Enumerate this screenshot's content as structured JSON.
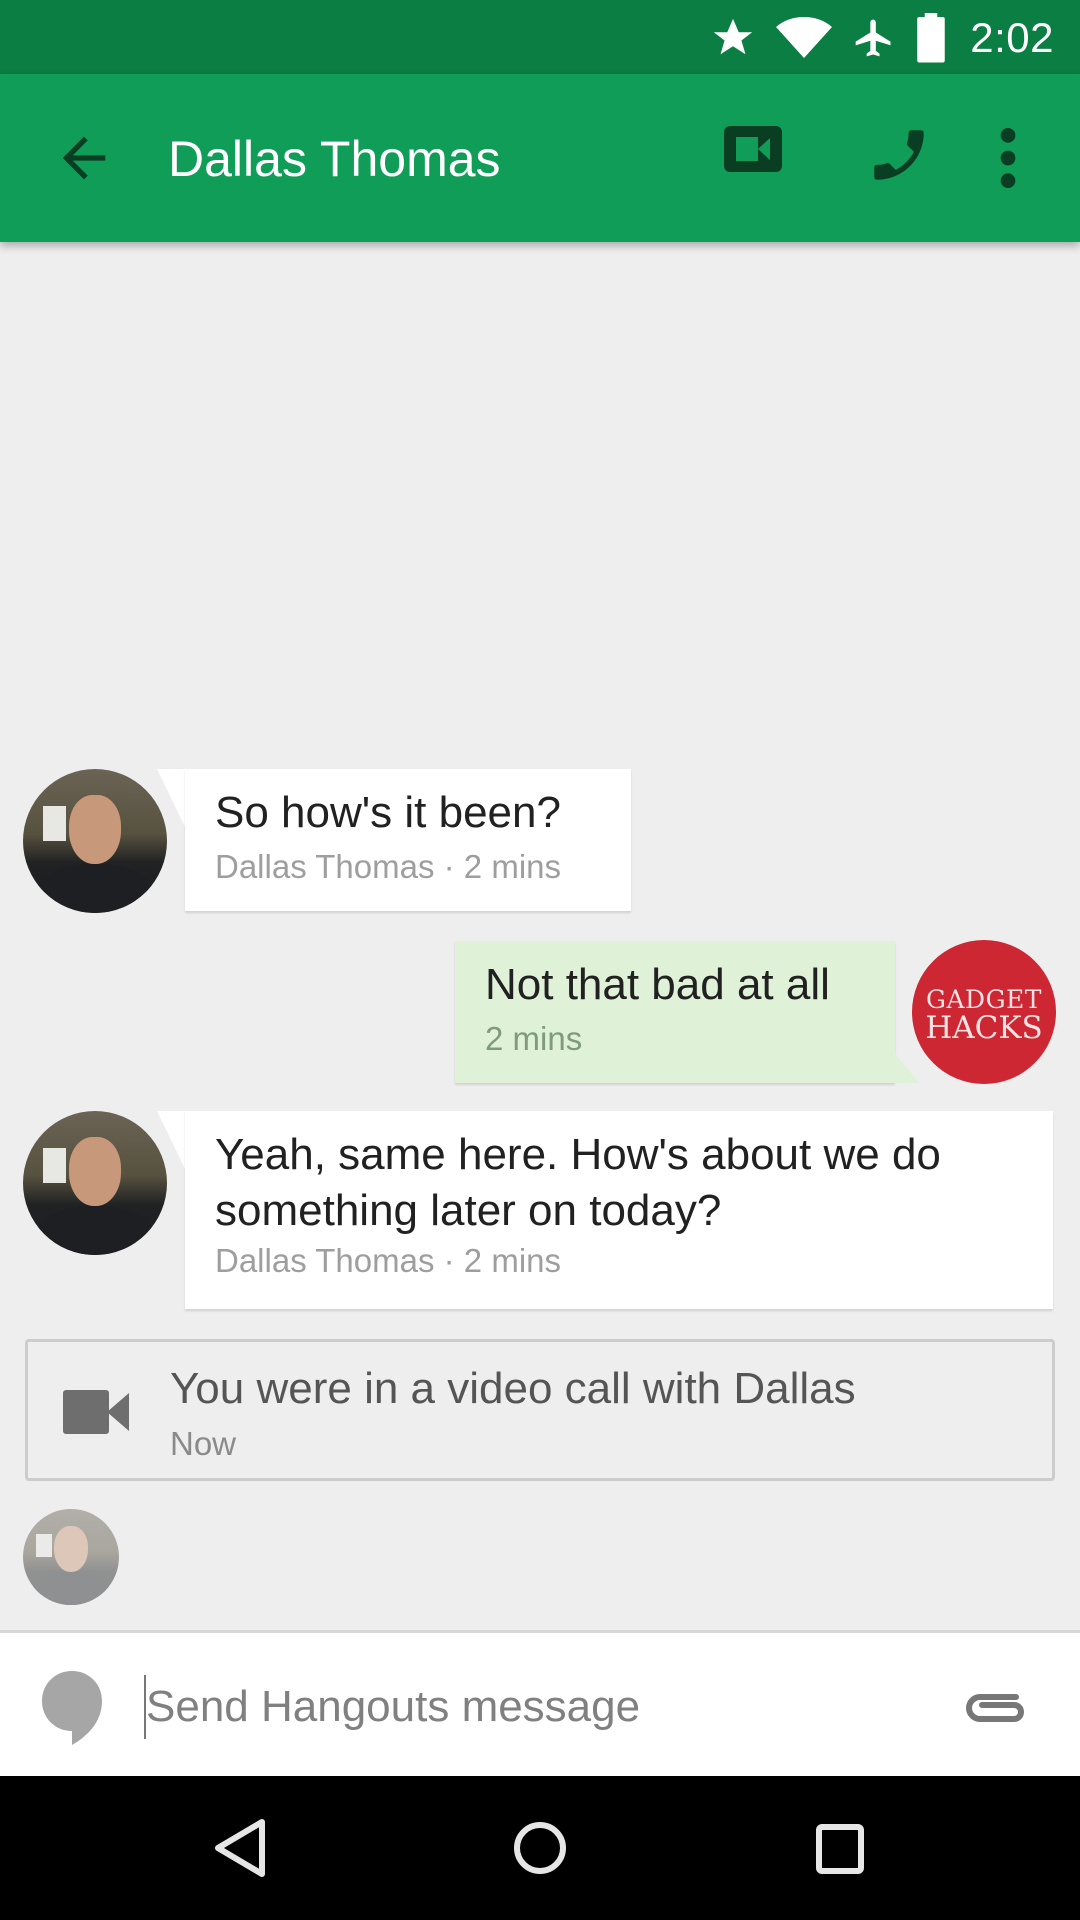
{
  "status_bar": {
    "time": "2:02",
    "icons": [
      "star-icon",
      "wifi-icon",
      "airplane-mode-icon",
      "battery-icon"
    ]
  },
  "app_bar": {
    "title": "Dallas Thomas",
    "back_icon": "arrow-back-icon",
    "actions": [
      "video-call-icon",
      "phone-icon",
      "more-vert-icon"
    ],
    "background": "#109d58",
    "status_background": "#0b7e43"
  },
  "messages": [
    {
      "direction": "incoming",
      "text": "So how's it been?",
      "meta": "Dallas Thomas · 2 mins",
      "avatar": "dallas-thomas-photo"
    },
    {
      "direction": "outgoing",
      "text": "Not that bad at all",
      "meta": "2 mins",
      "avatar": {
        "line1": "GADGET",
        "line2": "HACKS"
      },
      "bubble_color": "#dff2d8"
    },
    {
      "direction": "incoming",
      "text_line1": "Yeah, same here. How's about we do",
      "text_line2": "something later on today?",
      "meta": "Dallas Thomas · 2 mins",
      "avatar": "dallas-thomas-photo"
    }
  ],
  "call_event": {
    "icon": "videocam-icon",
    "text": "You were in a video call with Dallas",
    "time": "Now"
  },
  "read_receipt": {
    "avatar": "dallas-thomas-photo"
  },
  "compose": {
    "placeholder": "Send Hangouts message",
    "value": "",
    "left_icon": "hangouts-icon",
    "right_icon": "attach-icon"
  },
  "nav_bar": {
    "buttons": [
      "back",
      "home",
      "recents"
    ]
  },
  "colors": {
    "accent": "#109d58",
    "chat_background": "#eeeeee",
    "gadget_hacks_red": "#cc2733"
  }
}
